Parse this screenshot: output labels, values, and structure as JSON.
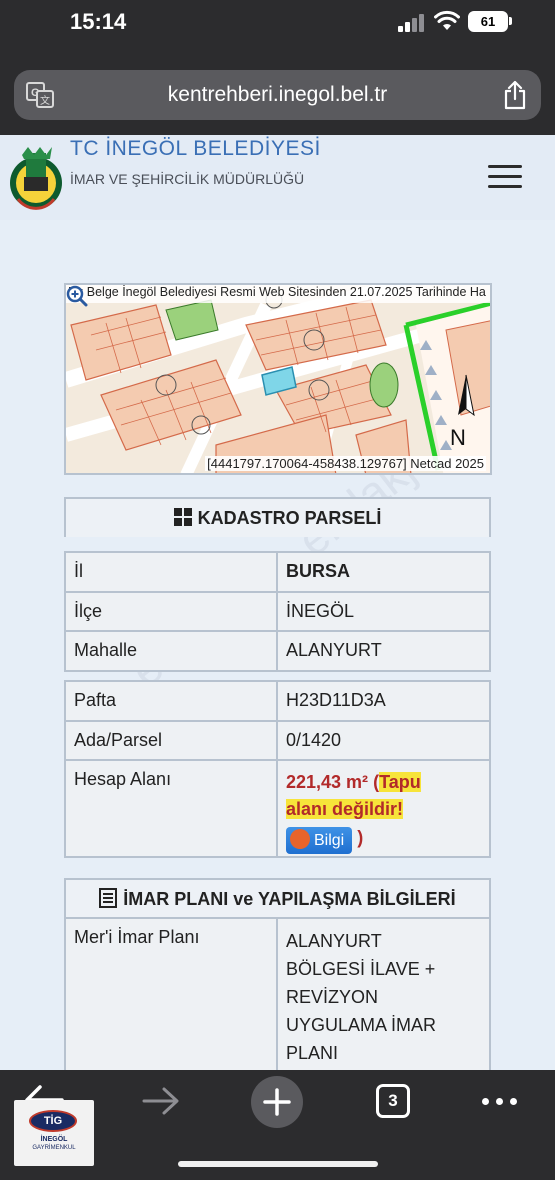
{
  "status_bar": {
    "time": "15:14",
    "battery": "61"
  },
  "browser": {
    "url": "kentrehberi.inegol.bel.tr",
    "tab_count": "3"
  },
  "site": {
    "title": "TC İNEGÖL BELEDİYESİ",
    "subtitle": "İMAR VE ŞEHİRCİLİK MÜDÜRLÜĞÜ"
  },
  "map": {
    "caption": "Bu Belge İnegöl Belediyesi Resmi Web Sitesinden 21.07.2025 Tarihinde Ha",
    "coords": "[4441797.170064-458438.129767] Netcad 2025",
    "north": "N"
  },
  "kadastro": {
    "title": "KADASTRO PARSELİ",
    "rows_a": [
      {
        "label": "İl",
        "value": "BURSA"
      },
      {
        "label": "İlçe",
        "value": "İNEGÖL"
      },
      {
        "label": "Mahalle",
        "value": "ALANYURT"
      }
    ],
    "rows_b": [
      {
        "label": "Pafta",
        "value": "H23D11D3A"
      },
      {
        "label": "Ada/Parsel",
        "value": "0/1420"
      }
    ],
    "hesap": {
      "label": "Hesap Alanı",
      "area": "221,43 m²",
      "open_paren": " (",
      "note_1": "Tapu",
      "note_2": "alanı değildir!",
      "bilgi": "Bilgi",
      "close_paren": " )"
    }
  },
  "imar": {
    "title": "İMAR PLANI ve YAPILAŞMA BİLGİLERİ",
    "label": "Mer'i İmar Planı",
    "value_lines": [
      "ALANYURT",
      "BÖLGESİ İLAVE +",
      "REVİZYON",
      "UYGULAMA İMAR",
      "PLANI"
    ]
  },
  "badge": {
    "logo": "TİG",
    "line1": "İNEGÖL",
    "line2": "GAYRİMENKUL"
  },
  "icons": {
    "translate": "translate-icon",
    "share": "share-icon",
    "menu": "hamburger-menu-icon",
    "zoom": "magnifier-plus-icon",
    "back": "arrow-left-icon",
    "forward": "arrow-right-icon",
    "new_tab": "plus-icon",
    "more": "ellipsis-icon"
  },
  "colors": {
    "title_blue": "#3a6fb5",
    "area_red": "#b22a2a",
    "highlight": "#f7e43a",
    "border": "#b7c2cf"
  }
}
